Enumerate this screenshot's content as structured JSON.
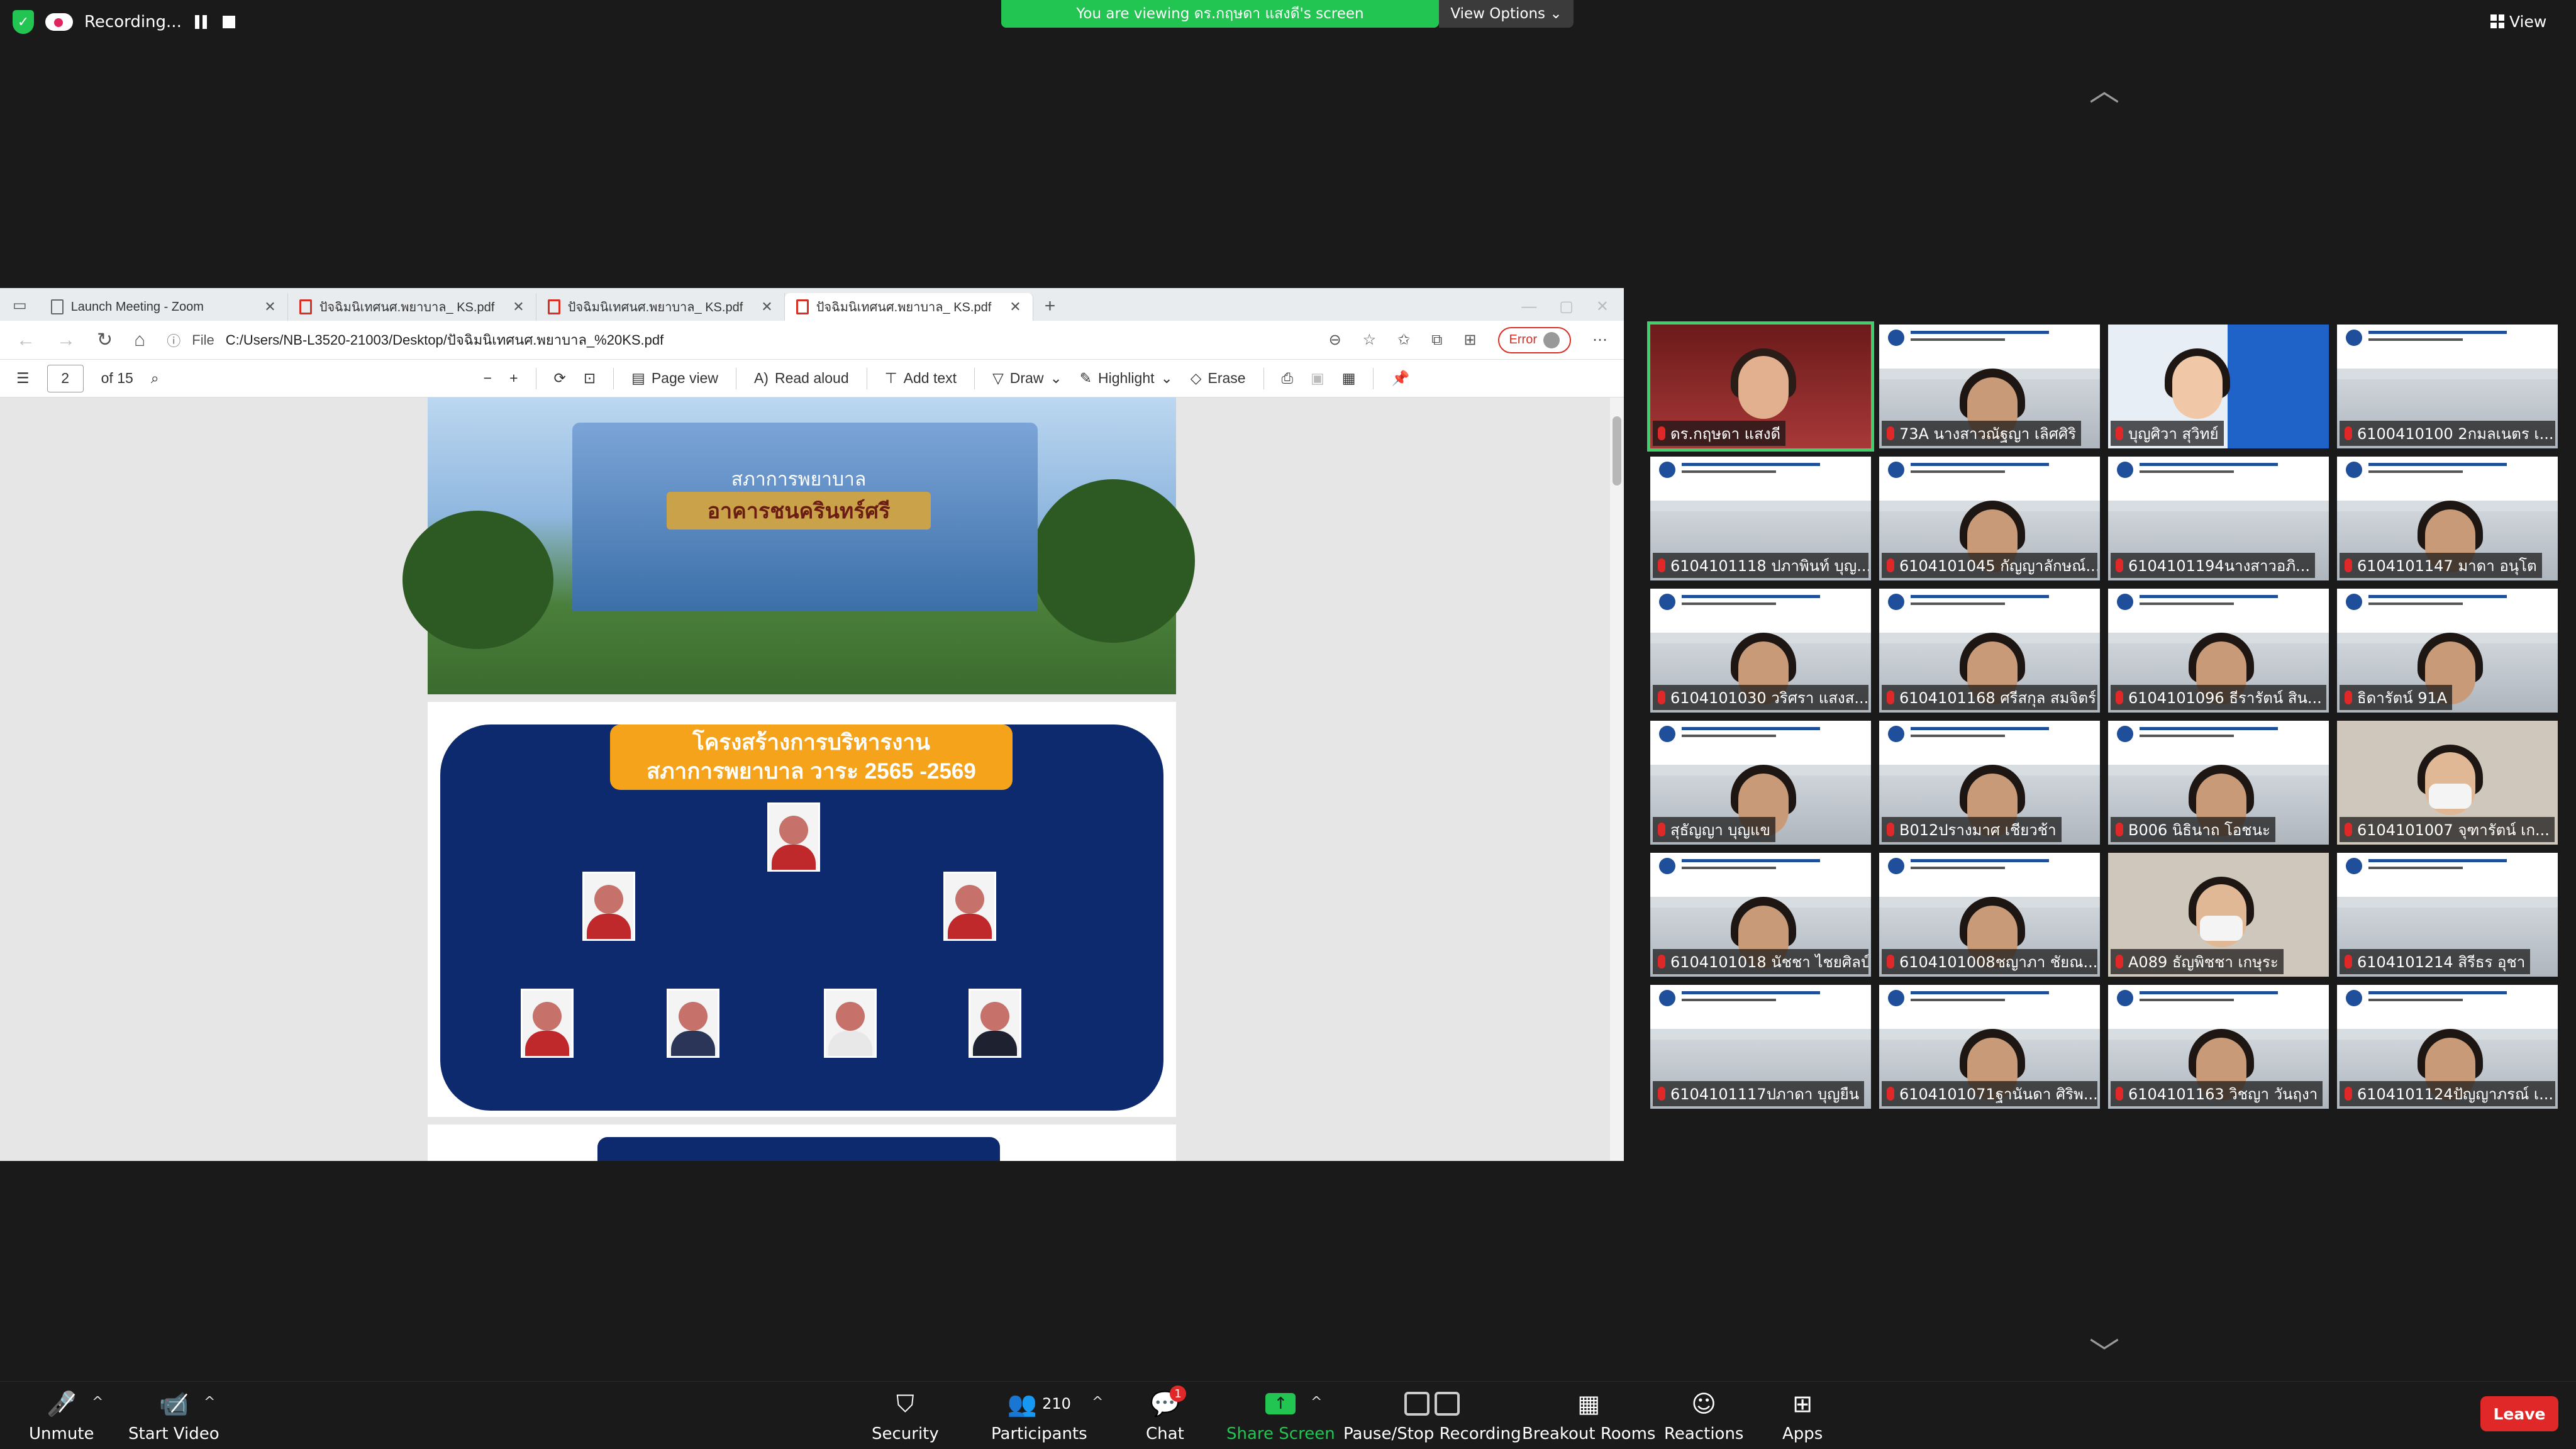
{
  "top": {
    "recording_label": "Recording...",
    "viewing_banner": "You are viewing ดร.กฤษดา  แสงดี's screen",
    "view_options": "View Options",
    "view_button": "View"
  },
  "browser": {
    "tabs": [
      {
        "title": "Launch Meeting - Zoom"
      },
      {
        "title": "ปัจฉิมนิเทศนศ.พยาบาล_ KS.pdf"
      },
      {
        "title": "ปัจฉิมนิเทศนศ.พยาบาล_ KS.pdf"
      },
      {
        "title": "ปัจฉิมนิเทศนศ.พยาบาล_ KS.pdf"
      }
    ],
    "file_label": "File",
    "url": "C:/Users/NB-L3520-21003/Desktop/ปัจฉิมนิเทศนศ.พยาบาล_%20KS.pdf",
    "error_label": "Error",
    "page_current": "2",
    "page_total": "of 15",
    "toolbar": {
      "page_view": "Page view",
      "read_aloud": "Read aloud",
      "add_text": "Add text",
      "draw": "Draw",
      "highlight": "Highlight",
      "erase": "Erase"
    }
  },
  "pdf": {
    "building_sign_top": "สภาการพยาบาล",
    "building_sign": "อาคารชนครินทร์ศรี",
    "org_title_line1": "โครงสร้างการบริหารงาน",
    "org_title_line2": "สภาการพยาบาล วาระ 2565 -2569"
  },
  "participants": [
    {
      "name": "ดร.กฤษดา  แสงดี",
      "active": true
    },
    {
      "name": "73A นางสาวณัฐญา เลิศศิริ"
    },
    {
      "name": "บุญศิวา สุวิทย์"
    },
    {
      "name": "6100410100 2กมลเนตร เ..."
    },
    {
      "name": "6104101118 ปภาพินท์ บุญ..."
    },
    {
      "name": "6104101045 กัญญาลักษณ์..."
    },
    {
      "name": "6104101194นางสาวอภิ..."
    },
    {
      "name": "6104101147 มาดา อนุโต"
    },
    {
      "name": "6104101030 วริศรา แสงส..."
    },
    {
      "name": "6104101168 ศรีสกุล สมจิตร์"
    },
    {
      "name": "6104101096 ธีรารัตน์ สิน..."
    },
    {
      "name": "ธิดารัตน์ 91A"
    },
    {
      "name": "สุธัญญา บุญแข"
    },
    {
      "name": "B012ปรางมาศ เชียวช้า"
    },
    {
      "name": "B006 นิธินาถ โอชนะ"
    },
    {
      "name": "6104101007 จุฑารัตน์ เก..."
    },
    {
      "name": "6104101018 นัชชา ไชยศิลป์"
    },
    {
      "name": "6104101008ชญาภา ชัยณ..."
    },
    {
      "name": "A089 ธัญพิชชา เกษุระ"
    },
    {
      "name": "6104101214 สิรีธร อุชา"
    },
    {
      "name": "6104101117ปภาดา บุญยืน"
    },
    {
      "name": "6104101071ฐานันดา ศิริพ..."
    },
    {
      "name": "6104101163 วิชญา วันฤงา"
    },
    {
      "name": "6104101124ปัญญาภรณ์ เ..."
    }
  ],
  "bottom": {
    "unmute": "Unmute",
    "start_video": "Start Video",
    "security": "Security",
    "participants": "Participants",
    "participant_count": "210",
    "chat": "Chat",
    "chat_badge": "1",
    "share_screen": "Share Screen",
    "pause_stop": "Pause/Stop Recording",
    "breakout": "Breakout Rooms",
    "reactions": "Reactions",
    "apps": "Apps",
    "leave": "Leave"
  },
  "colors": {
    "zoom_green": "#23c552",
    "leave_red": "#e02828",
    "org_navy": "#0e2a6e",
    "org_orange": "#f4a31a"
  }
}
